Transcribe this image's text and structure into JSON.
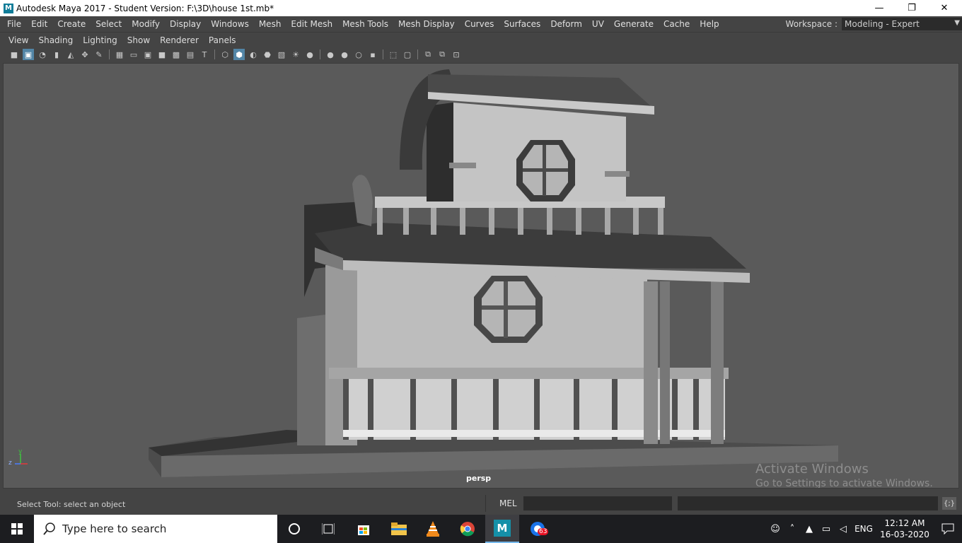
{
  "window": {
    "title": "Autodesk Maya 2017 - Student Version: F:\\3D\\house 1st.mb*",
    "app_icon": "M",
    "minimize": "—",
    "maximize": "❐",
    "close": "✕"
  },
  "menubar": {
    "items": [
      "File",
      "Edit",
      "Create",
      "Select",
      "Modify",
      "Display",
      "Windows",
      "Mesh",
      "Edit Mesh",
      "Mesh Tools",
      "Mesh Display",
      "Curves",
      "Surfaces",
      "Deform",
      "UV",
      "Generate",
      "Cache",
      "Help"
    ],
    "workspace_label": "Workspace :",
    "workspace_value": "Modeling - Expert"
  },
  "panel_menu": {
    "items": [
      "View",
      "Shading",
      "Lighting",
      "Show",
      "Renderer",
      "Panels"
    ]
  },
  "viewport": {
    "camera_label": "persp",
    "axis_labels": {
      "y": "y",
      "z": "z",
      "x": "x"
    },
    "watermark_line1": "Activate Windows",
    "watermark_line2": "Go to Settings to activate Windows."
  },
  "statusbar": {
    "help_text": "Select Tool: select an object",
    "mel_label": "MEL",
    "script_editor_icon": "{;}"
  },
  "taskbar": {
    "search_placeholder": "Type here to search",
    "language": "ENG",
    "time": "12:12 AM",
    "date": "16-03-2020",
    "badge_count": "63",
    "maya_icon_text": "M"
  },
  "colors": {
    "maya_bg": "#444444",
    "viewport_bg": "#5a5a5a",
    "taskbar_bg": "#1c1d20",
    "highlight": "#5285a6"
  }
}
